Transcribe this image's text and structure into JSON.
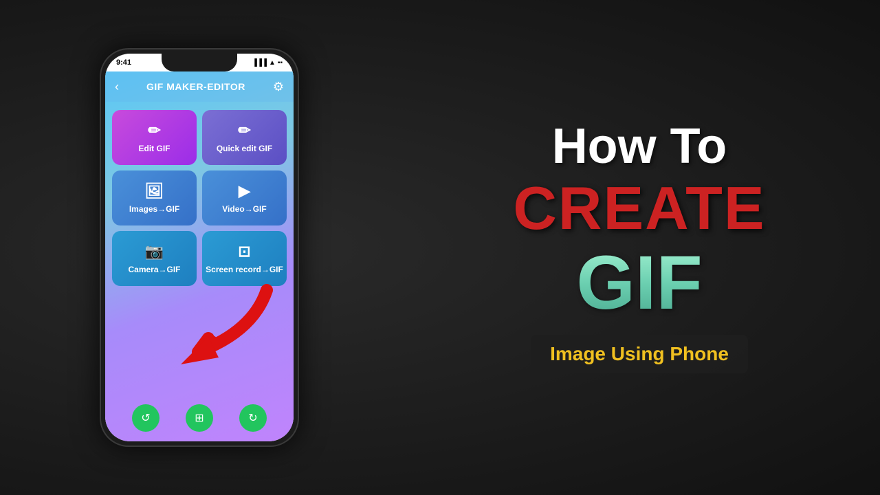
{
  "scene": {
    "background": "#1a1a1a"
  },
  "phone": {
    "status": {
      "time": "9:41",
      "icons": "▐▐▐ ▲ ▪"
    },
    "header": {
      "back_label": "‹",
      "title": "GIF MAKER-EDITOR",
      "settings_label": "⚙"
    },
    "buttons": [
      {
        "id": "edit-gif",
        "label": "Edit GIF",
        "icon": "✏"
      },
      {
        "id": "quick-edit-gif",
        "label": "Quick edit GIF",
        "icon": "✏"
      },
      {
        "id": "images-gif",
        "label": "Images→GIF",
        "icon": "🖼"
      },
      {
        "id": "video-gif",
        "label": "Video→GIF",
        "icon": "▷"
      },
      {
        "id": "camera-gif",
        "label": "Camera→GIF",
        "icon": "📷"
      },
      {
        "id": "screen-record-gif",
        "label": "Screen record→GIF",
        "icon": "⊡"
      }
    ],
    "nav_buttons": [
      {
        "id": "nav-history",
        "icon": "↺"
      },
      {
        "id": "nav-crop",
        "icon": "⊞"
      },
      {
        "id": "nav-image",
        "icon": "↻"
      }
    ]
  },
  "text_content": {
    "how_to": "How To",
    "create": "CREATE",
    "gif": "GIF",
    "subtitle": "Image Using Phone"
  }
}
